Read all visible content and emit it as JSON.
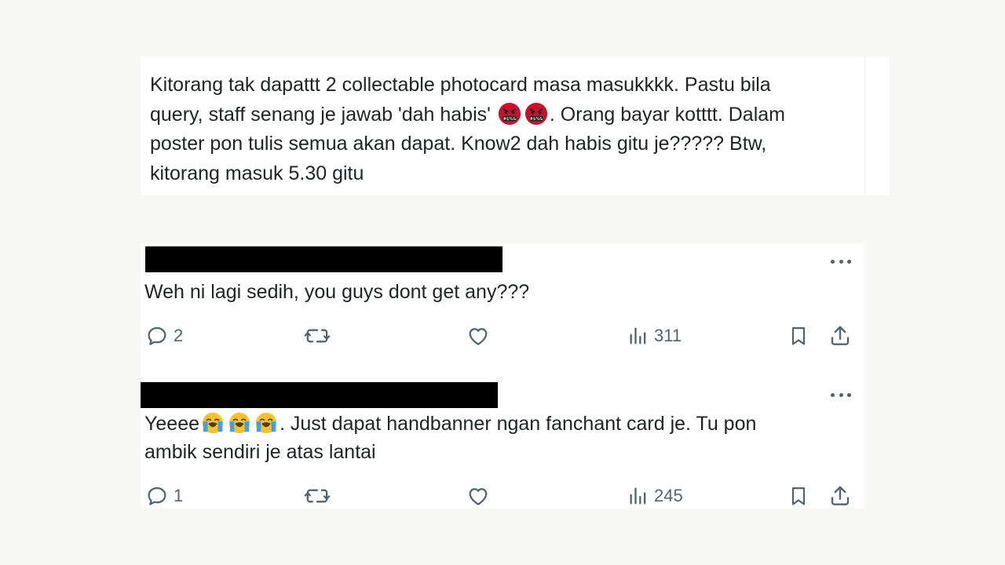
{
  "main_post": {
    "line1": "Kitorang tak dapattt 2 collectable photocard masa masukkkk. Pastu bila",
    "line2_a": "query, staff senang je jawab 'dah habis'",
    "line2_emoji": "angry-face-with-symbols",
    "line2_b": ". Orang bayar kotttt. Dalam",
    "line3": "poster pon tulis semua akan dapat. Know2 dah habis gitu je????? Btw,",
    "line4": "kitorang masuk 5.30 gitu"
  },
  "replies": [
    {
      "text": "Weh ni lagi sedih, you guys dont get any???",
      "reply_count": "2",
      "view_count": "311"
    },
    {
      "text_a": "Yeeee",
      "text_emoji": "loudly-crying-face",
      "text_b": ". Just dapat handbanner ngan fanchant card je. Tu pon",
      "text_line2": "ambik sendiri je atas lantai",
      "reply_count": "1",
      "view_count": "245"
    }
  ],
  "icons": {
    "reply": "reply-icon",
    "retweet": "retweet-icon",
    "like": "like-icon",
    "views": "views-icon",
    "bookmark": "bookmark-icon",
    "share": "share-icon",
    "more": "more-icon"
  },
  "colors": {
    "icon_gray": "#536471",
    "text": "#1f2328",
    "redaction": "#000000"
  }
}
